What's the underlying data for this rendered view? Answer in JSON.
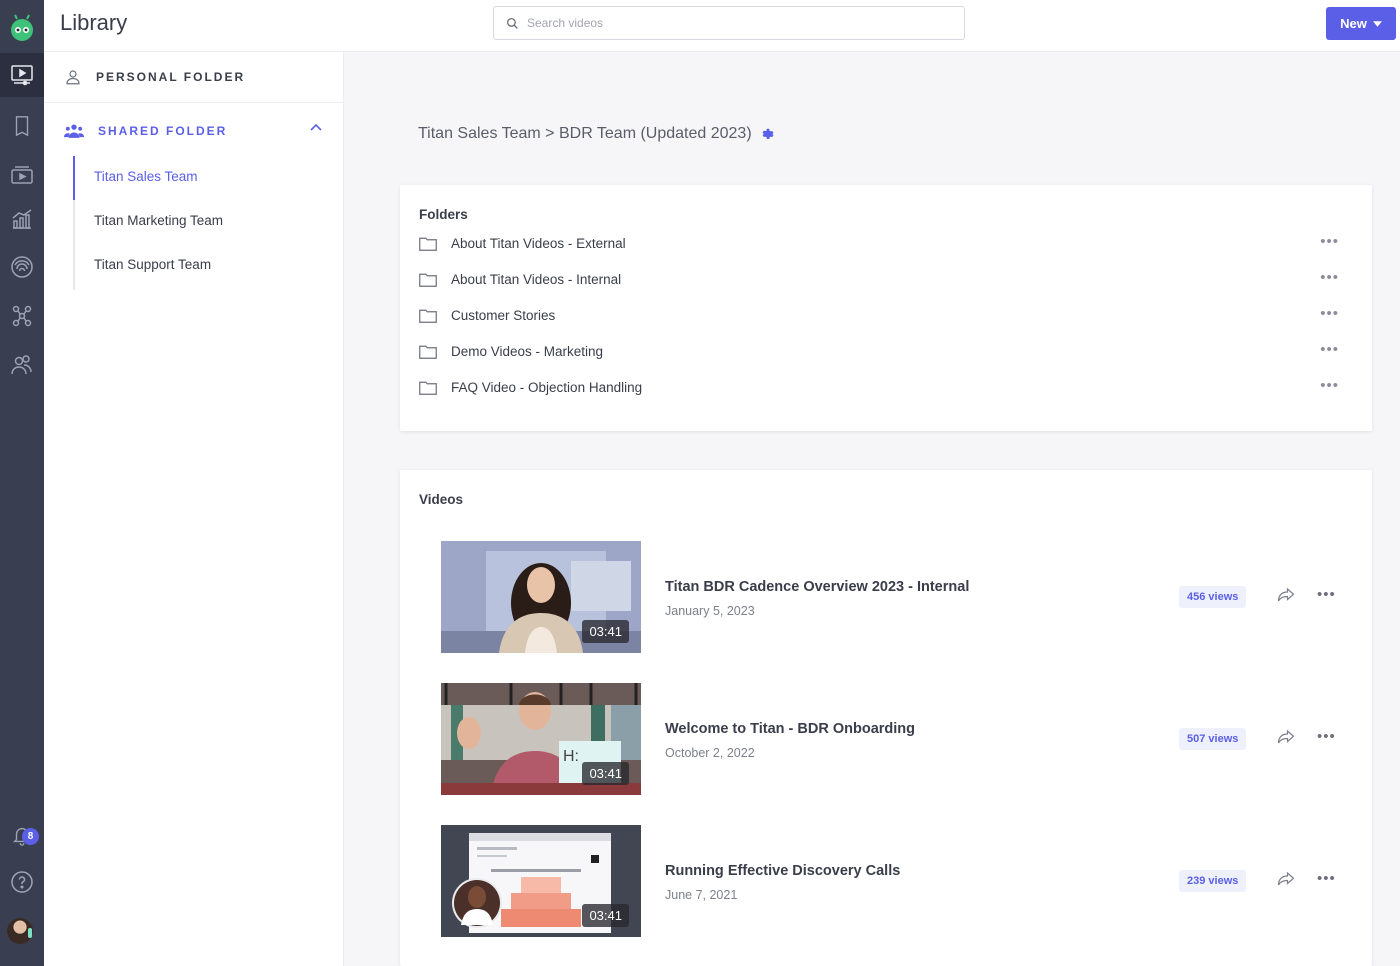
{
  "header": {
    "title": "Library",
    "search_placeholder": "Search videos",
    "new_label": "New"
  },
  "rail": {
    "items": [
      {
        "icon": "video-library-icon",
        "active": true
      },
      {
        "icon": "document-icon"
      },
      {
        "icon": "playlist-icon"
      },
      {
        "icon": "analytics-icon"
      },
      {
        "icon": "fingerprint-icon"
      },
      {
        "icon": "integrations-icon"
      },
      {
        "icon": "team-icon"
      }
    ],
    "notification_count": "8",
    "help_icon": "help-icon"
  },
  "sidebar": {
    "personal_label": "PERSONAL FOLDER",
    "shared_label": "SHARED FOLDER",
    "teams": [
      {
        "label": "Titan Sales Team",
        "active": true
      },
      {
        "label": "Titan Marketing Team"
      },
      {
        "label": "Titan Support Team"
      }
    ]
  },
  "breadcrumb": {
    "text": "Titan Sales Team > BDR Team (Updated 2023)"
  },
  "folders": {
    "title": "Folders",
    "items": [
      {
        "name": "About Titan Videos - External"
      },
      {
        "name": "About Titan Videos - Internal"
      },
      {
        "name": "Customer Stories"
      },
      {
        "name": "Demo Videos - Marketing"
      },
      {
        "name": "FAQ Video - Objection Handling"
      }
    ]
  },
  "videos": {
    "title": "Videos",
    "items": [
      {
        "title": "Titan BDR Cadence Overview 2023 - Internal",
        "date": "January 5, 2023",
        "views": "456 views",
        "duration": "03:41"
      },
      {
        "title": "Welcome to Titan - BDR Onboarding",
        "date": "October 2, 2022",
        "views": "507 views",
        "duration": "03:41"
      },
      {
        "title": "Running Effective Discovery Calls",
        "date": "June 7, 2021",
        "views": "239 views",
        "duration": "03:41"
      }
    ]
  },
  "colors": {
    "accent": "#5b5fe8",
    "rail": "#393e51",
    "text": "#3a3d4a"
  }
}
